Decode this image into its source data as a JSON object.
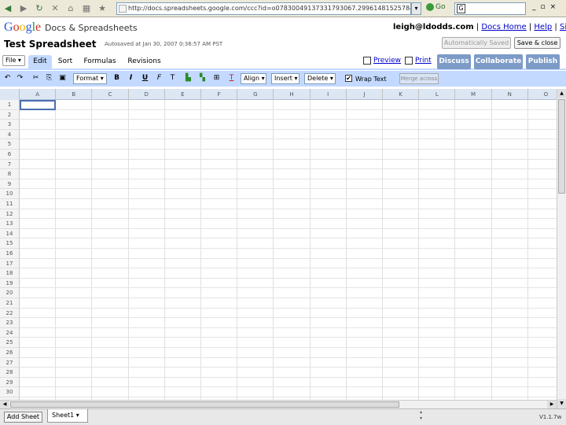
{
  "browser": {
    "url": "http://docs.spreadsheets.google.com/ccc?id=o07830049137331793067.2996148152578454601.0715336",
    "window_controls": [
      "_",
      "▫",
      "×"
    ]
  },
  "header": {
    "logo": "Google",
    "product": "Docs & Spreadsheets",
    "user_email": "leigh@ldodds.com",
    "separator": "|",
    "links": [
      "Docs Home",
      "Help",
      "Sign Out"
    ]
  },
  "document": {
    "title": "Test Spreadsheet",
    "autosave_text": "Autosaved at Jan 30, 2007 0:36:57 AM PST",
    "autosaved_button": "Automatically Saved",
    "save_close_button": "Save & close"
  },
  "tabs": {
    "file_menu": "File ▾",
    "items": [
      "Edit",
      "Sort",
      "Formulas",
      "Revisions"
    ],
    "active": "Edit",
    "preview": "Preview",
    "print": "Print",
    "actions": [
      "Discuss",
      "Collaborate",
      "Publish"
    ]
  },
  "toolbar": {
    "format": "Format ▾",
    "align": "Align ▾",
    "insert": "Insert ▾",
    "delete": "Delete ▾",
    "wrap_text": "Wrap Text",
    "wrap_checked": "✔",
    "merge_across": "Merge across",
    "icons": {
      "undo": "↶",
      "redo": "↷",
      "cut": "✂",
      "copy": "⎘",
      "paste": "📋",
      "bold": "B",
      "italic": "I",
      "underline": "U",
      "font": "F",
      "size": "T",
      "color": "T"
    }
  },
  "grid": {
    "columns": [
      "A",
      "B",
      "C",
      "D",
      "E",
      "F",
      "G",
      "H",
      "I",
      "J",
      "K",
      "L",
      "M",
      "N",
      "O"
    ],
    "rows": [
      "1",
      "2",
      "3",
      "4",
      "5",
      "6",
      "7",
      "8",
      "9",
      "10",
      "11",
      "12",
      "13",
      "14",
      "15",
      "16",
      "17",
      "18",
      "19",
      "20",
      "21",
      "22",
      "23",
      "24",
      "25",
      "26",
      "27",
      "28",
      "29",
      "30",
      "31"
    ]
  },
  "footer": {
    "add_sheet": "Add Sheet",
    "sheet_tab": "Sheet1 ▾",
    "version": "V1.1.7w"
  },
  "colors": {
    "tab_active": "#c3d9ff",
    "action_button": "#7d9bc7",
    "link": "#0000cc"
  }
}
